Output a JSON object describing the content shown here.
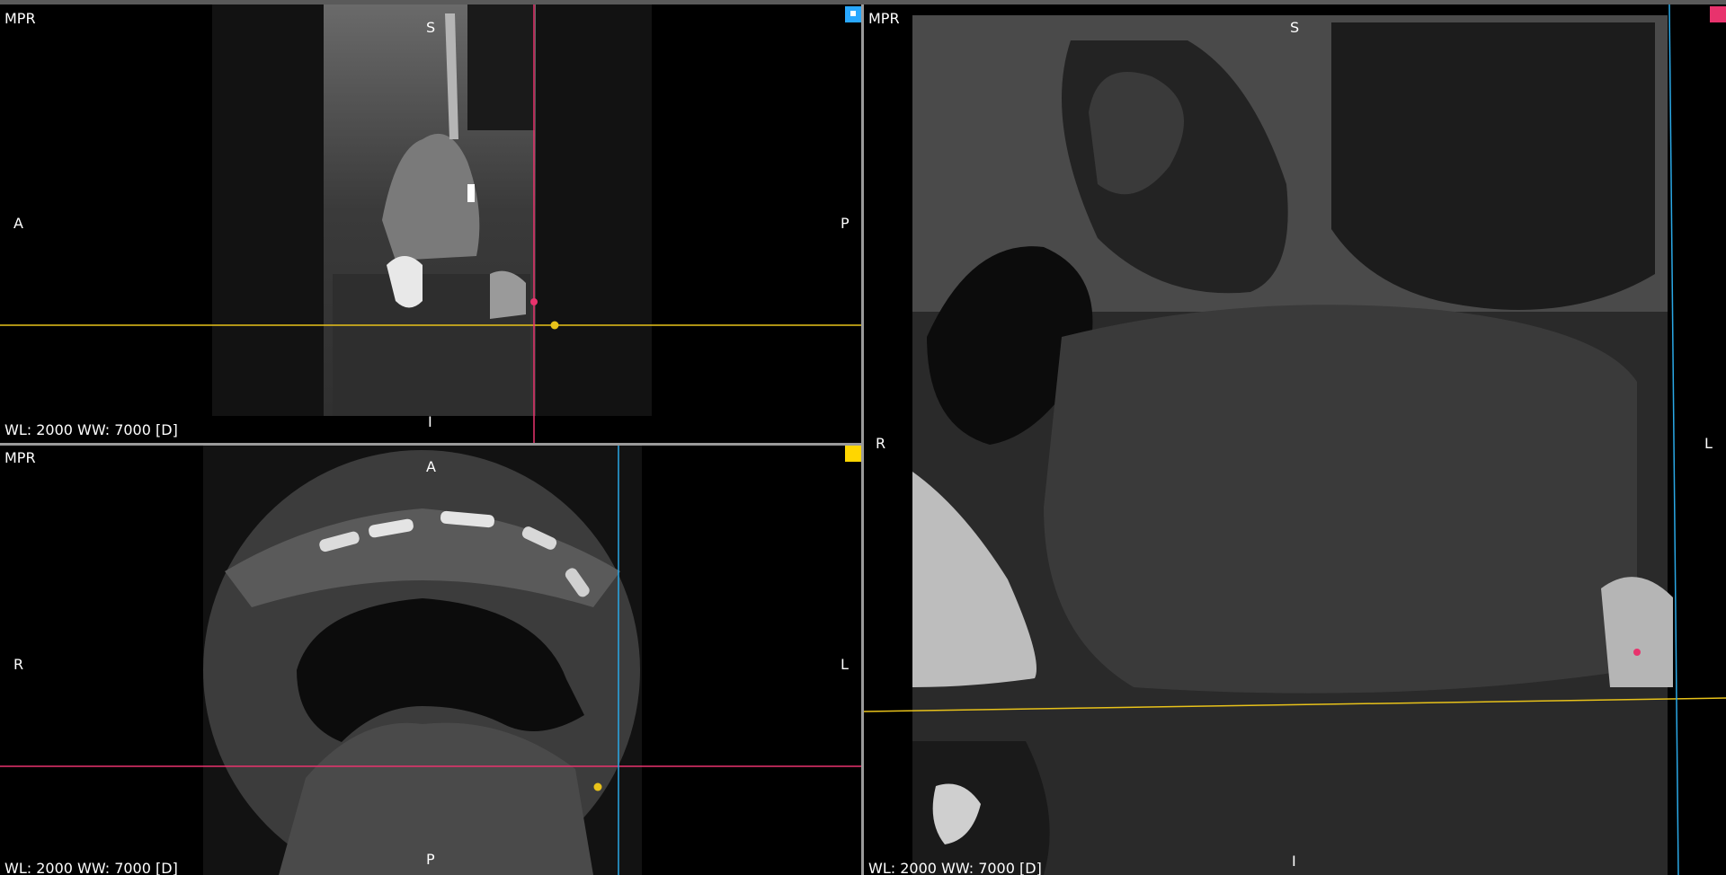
{
  "viewports": {
    "sagittal": {
      "mode": "MPR",
      "window": "WL: 2000 WW: 7000 [D]",
      "orient": {
        "top": "S",
        "bottom": "I",
        "left": "A",
        "right": "P"
      },
      "marker_color": "#29a8ff"
    },
    "axial": {
      "mode": "MPR",
      "window": "WL: 2000 WW: 7000 [D]",
      "orient": {
        "top": "A",
        "bottom": "P",
        "left": "R",
        "right": "L"
      },
      "marker_color": "#ffd600"
    },
    "coronal": {
      "mode": "MPR",
      "window": "WL: 2000 WW: 7000 [D]",
      "orient": {
        "top": "S",
        "bottom": "I",
        "left": "R",
        "right": "L"
      },
      "marker_color": "#e8336d"
    }
  },
  "crosshair_colors": {
    "yellow": "#e8c21a",
    "pink": "#e8336d",
    "blue": "#2aa8e6"
  }
}
